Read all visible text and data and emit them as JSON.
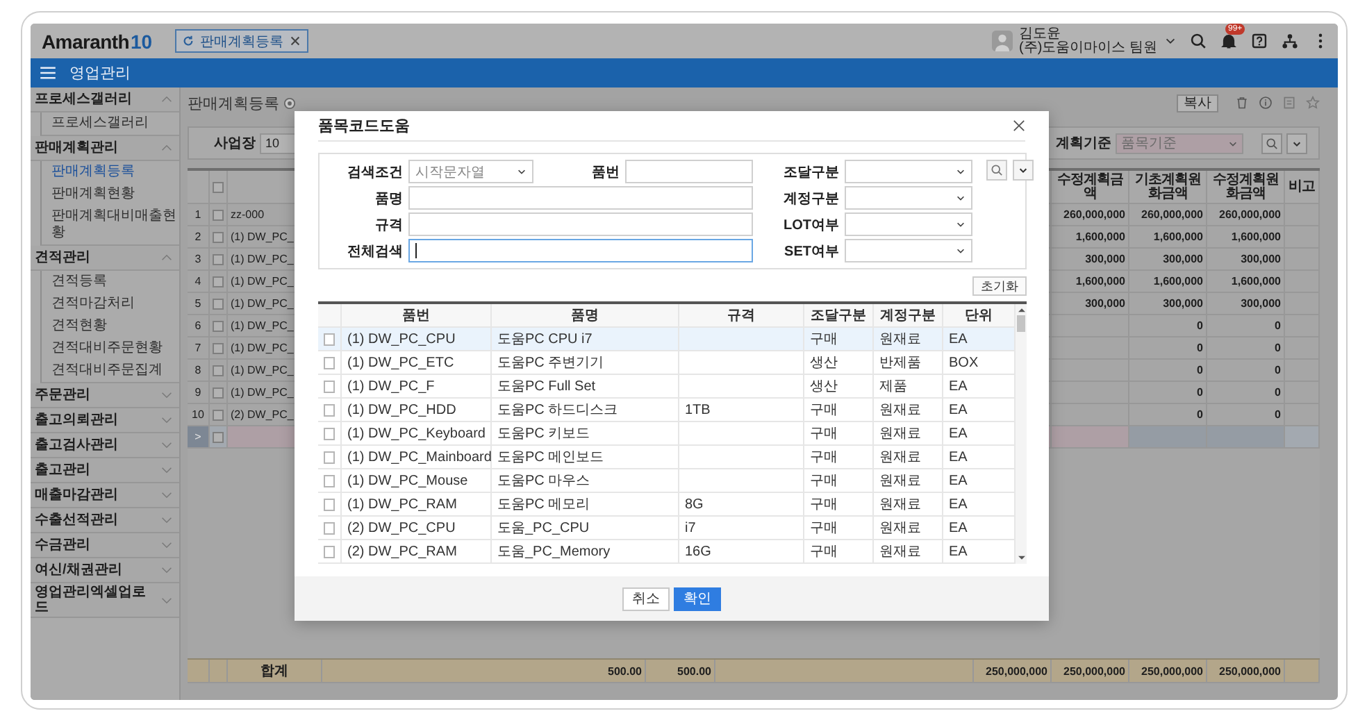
{
  "topbar": {
    "logo_name": "Amaranth",
    "logo_version": "10",
    "tabs": [
      {
        "label": "판매계획등록",
        "selected": true
      }
    ],
    "user_name": "김도윤",
    "user_org": "(주)도움이마이스 팀원",
    "badge": "99+"
  },
  "module_bar": {
    "title": "영업관리"
  },
  "sidebar": {
    "groups": [
      {
        "label": "프로세스갤러리",
        "expanded": true,
        "children": [
          {
            "label": "프로세스갤러리",
            "selected": false
          }
        ]
      },
      {
        "label": "판매계획관리",
        "expanded": true,
        "children": [
          {
            "label": "판매계획등록",
            "selected": true
          },
          {
            "label": "판매계획현황",
            "selected": false
          },
          {
            "label": "판매계획대비매출현황",
            "selected": false
          }
        ]
      },
      {
        "label": "견적관리",
        "expanded": true,
        "children": [
          {
            "label": "견적등록",
            "selected": false
          },
          {
            "label": "견적마감처리",
            "selected": false
          },
          {
            "label": "견적현황",
            "selected": false
          },
          {
            "label": "견적대비주문현황",
            "selected": false
          },
          {
            "label": "견적대비주문집계",
            "selected": false
          }
        ]
      },
      {
        "label": "주문관리",
        "expanded": false
      },
      {
        "label": "출고의뢰관리",
        "expanded": false
      },
      {
        "label": "출고검사관리",
        "expanded": false
      },
      {
        "label": "출고관리",
        "expanded": false
      },
      {
        "label": "매출마감관리",
        "expanded": false
      },
      {
        "label": "수출선적관리",
        "expanded": false
      },
      {
        "label": "수금관리",
        "expanded": false
      },
      {
        "label": "여신/채권관리",
        "expanded": false
      },
      {
        "label": "영업관리엑셀업로드",
        "expanded": false
      }
    ]
  },
  "page": {
    "title": "판매계획등록",
    "copy_button": "복사",
    "filters": [
      {
        "label": "사업장",
        "value": "10"
      },
      {
        "label": "계획기준",
        "placeholder": "품목기준"
      }
    ]
  },
  "grid": {
    "header_checked": false,
    "columns": [
      "수정계획금액",
      "기초계획원화금액",
      "수정계획원화금액",
      "비고"
    ],
    "rows": [
      {
        "no": "1",
        "checked": false,
        "code": "zz-000",
        "amounts": [
          "260,000,000",
          "260,000,000",
          "260,000,000"
        ]
      },
      {
        "no": "2",
        "checked": false,
        "code": "(1) DW_PC_",
        "amounts": [
          "1,600,000",
          "1,600,000",
          "1,600,000"
        ]
      },
      {
        "no": "3",
        "checked": false,
        "code": "(1) DW_PC_",
        "amounts": [
          "300,000",
          "300,000",
          "300,000"
        ]
      },
      {
        "no": "4",
        "checked": false,
        "code": "(1) DW_PC_",
        "amounts": [
          "1,600,000",
          "1,600,000",
          "1,600,000"
        ]
      },
      {
        "no": "5",
        "checked": false,
        "code": "(1) DW_PC_",
        "amounts": [
          "300,000",
          "300,000",
          "300,000"
        ]
      },
      {
        "no": "6",
        "checked": false,
        "code": "(1) DW_PC_",
        "amounts": [
          "0",
          "0"
        ]
      },
      {
        "no": "7",
        "checked": false,
        "code": "(1) DW_PC_",
        "amounts": [
          "0",
          "0"
        ]
      },
      {
        "no": "8",
        "checked": false,
        "code": "(1) DW_PC_",
        "amounts": [
          "0",
          "0"
        ]
      },
      {
        "no": "9",
        "checked": false,
        "code": "(1) DW_PC_",
        "amounts": [
          "0",
          "0"
        ]
      },
      {
        "no": "10",
        "checked": false,
        "code": "(2) DW_PC_",
        "amounts": [
          "0",
          "0"
        ]
      }
    ],
    "new_row": {
      "marker": ">",
      "checked": false
    },
    "footer": {
      "label": "합계",
      "quantities": [
        "500.00",
        "500.00"
      ],
      "amounts": [
        "250,000,000",
        "250,000,000",
        "250,000,000",
        "250,000,000"
      ]
    }
  },
  "dialog": {
    "title": "품목코드도움",
    "search_fields": [
      {
        "kind": "select",
        "label": "검색조건",
        "placeholder": "시작문자열",
        "wide": false,
        "focused": false
      },
      {
        "kind": "input",
        "label": "품번",
        "wide": false,
        "focused": false
      },
      {
        "kind": "select",
        "label": "조달구분",
        "wide": false,
        "focused": false
      },
      {
        "kind": "input",
        "label": "품명",
        "wide": true,
        "focused": false
      },
      {
        "kind": "select",
        "label": "계정구분",
        "wide": false,
        "focused": false
      },
      {
        "kind": "input",
        "label": "규격",
        "wide": true,
        "focused": false
      },
      {
        "kind": "select",
        "label": "LOT여부",
        "wide": false,
        "focused": false
      },
      {
        "kind": "input",
        "label": "전체검색",
        "wide": true,
        "focused": true
      },
      {
        "kind": "select",
        "label": "SET여부",
        "wide": false,
        "focused": false
      }
    ],
    "reset_button": "초기화",
    "columns": [
      "품번",
      "품명",
      "규격",
      "조달구분",
      "계정구분",
      "단위"
    ],
    "rows": [
      {
        "checked": false,
        "selected": true,
        "code": "(1) DW_PC_CPU",
        "name": "도움PC CPU i7",
        "procurement": "구매",
        "account": "원재료",
        "unit": "EA"
      },
      {
        "checked": false,
        "selected": false,
        "code": "(1) DW_PC_ETC",
        "name": "도움PC 주변기기",
        "procurement": "생산",
        "account": "반제품",
        "unit": "BOX"
      },
      {
        "checked": false,
        "selected": false,
        "code": "(1) DW_PC_F",
        "name": "도움PC Full Set",
        "procurement": "생산",
        "account": "제품",
        "unit": "EA"
      },
      {
        "checked": false,
        "selected": false,
        "code": "(1) DW_PC_HDD",
        "name": "도움PC 하드디스크",
        "spec": "1TB",
        "procurement": "구매",
        "account": "원재료",
        "unit": "EA"
      },
      {
        "checked": false,
        "selected": false,
        "code": "(1) DW_PC_Keyboard",
        "name": "도움PC 키보드",
        "procurement": "구매",
        "account": "원재료",
        "unit": "EA"
      },
      {
        "checked": false,
        "selected": false,
        "code": "(1) DW_PC_Mainboard",
        "name": "도움PC 메인보드",
        "procurement": "구매",
        "account": "원재료",
        "unit": "EA"
      },
      {
        "checked": false,
        "selected": false,
        "code": "(1) DW_PC_Mouse",
        "name": "도움PC 마우스",
        "procurement": "구매",
        "account": "원재료",
        "unit": "EA"
      },
      {
        "checked": false,
        "selected": false,
        "code": "(1) DW_PC_RAM",
        "name": "도움PC 메모리",
        "spec": "8G",
        "procurement": "구매",
        "account": "원재료",
        "unit": "EA"
      },
      {
        "checked": false,
        "selected": false,
        "code": "(2) DW_PC_CPU",
        "name": "도움_PC_CPU",
        "spec": "i7",
        "procurement": "구매",
        "account": "원재료",
        "unit": "EA"
      },
      {
        "checked": false,
        "selected": false,
        "code": "(2) DW_PC_RAM",
        "name": "도움_PC_Memory",
        "spec": "16G",
        "procurement": "구매",
        "account": "원재료",
        "unit": "EA"
      }
    ],
    "buttons": [
      {
        "label": "취소",
        "kind": "secondary"
      },
      {
        "label": "확인",
        "kind": "primary"
      }
    ]
  }
}
